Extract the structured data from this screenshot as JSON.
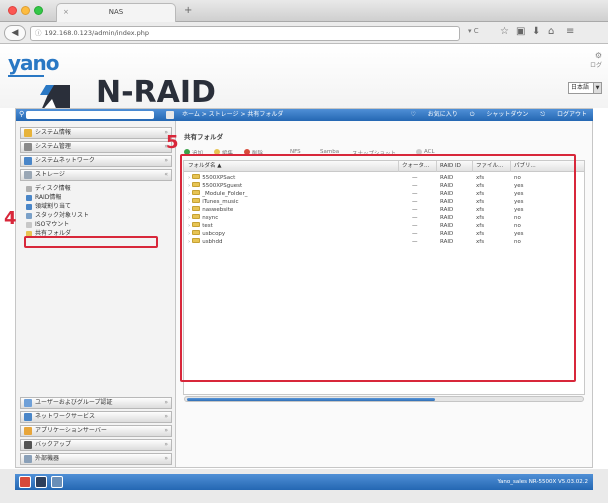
{
  "browser": {
    "tab_title": "NAS",
    "tab_close": "×",
    "new_tab": "+",
    "url": "192.168.0.123/admin/index.php",
    "back_icon": "back-arrow-icon",
    "toolbar_icons": [
      "star-icon",
      "bookmarks-icon",
      "download-icon",
      "home-icon",
      "menu-icon"
    ]
  },
  "header": {
    "vendor_logo": "yano",
    "product_name": "N-RAID",
    "right_link_top": "ログ",
    "right_link_sub": "ログ",
    "language": "日本語"
  },
  "breadcrumb": {
    "path": "ホーム > ストレージ > 共有フォルダ",
    "favorites": "お気に入り",
    "shutdown": "シャットダウン",
    "logout": "ログアウト"
  },
  "sidebar": {
    "menu_items": [
      {
        "label": "システム情報",
        "icon": "info-icon"
      },
      {
        "label": "システム管理",
        "icon": "tools-icon"
      },
      {
        "label": "システムネットワーク",
        "icon": "network-icon"
      },
      {
        "label": "ストレージ",
        "icon": "storage-icon"
      }
    ],
    "storage_sub": [
      "ディスク情報",
      "RAID情報",
      "領域割り当て",
      "スタック対象リスト",
      "ISOマウント",
      "共有フォルダ"
    ],
    "bottom_items": [
      {
        "label": "ユーザーおよびグループ認証",
        "icon": "users-icon"
      },
      {
        "label": "ネットワークサービス",
        "icon": "network-service-icon"
      },
      {
        "label": "アプリケーションサーバー",
        "icon": "app-server-icon"
      },
      {
        "label": "バックアップ",
        "icon": "backup-icon"
      },
      {
        "label": "外部機器",
        "icon": "external-device-icon"
      }
    ]
  },
  "callouts": {
    "sidebar": "4",
    "grid": "5"
  },
  "content": {
    "title": "共有フォルダ",
    "toolbar": [
      "追加",
      "編集",
      "削除",
      "NFS",
      "Samba",
      "スナップショット",
      "ACL"
    ],
    "columns": [
      "フォルダ名 ▲",
      "クォータ...",
      "RAID ID",
      "ファイル...",
      "パブリ..."
    ],
    "rows": [
      {
        "name": "5500XPSact",
        "quota": "—",
        "raid": "RAID",
        "fs": "xfs",
        "public": "no"
      },
      {
        "name": "5500XPSguest",
        "quota": "—",
        "raid": "RAID",
        "fs": "xfs",
        "public": "yes"
      },
      {
        "name": "_Module_Folder_",
        "quota": "—",
        "raid": "RAID",
        "fs": "xfs",
        "public": "yes"
      },
      {
        "name": "iTunes_music",
        "quota": "—",
        "raid": "RAID",
        "fs": "xfs",
        "public": "yes"
      },
      {
        "name": "naswebsite",
        "quota": "—",
        "raid": "RAID",
        "fs": "xfs",
        "public": "yes"
      },
      {
        "name": "nsync",
        "quota": "—",
        "raid": "RAID",
        "fs": "xfs",
        "public": "no"
      },
      {
        "name": "test",
        "quota": "—",
        "raid": "RAID",
        "fs": "xfs",
        "public": "no"
      },
      {
        "name": "usbcopy",
        "quota": "—",
        "raid": "RAID",
        "fs": "xfs",
        "public": "yes"
      },
      {
        "name": "usbhdd",
        "quota": "—",
        "raid": "RAID",
        "fs": "xfs",
        "public": "no"
      }
    ]
  },
  "status": {
    "text": "Yano_sales  NR-5500X  V5.03.02.2",
    "colors": {
      "accent": "#2467b2",
      "highlight": "#d8273a"
    }
  }
}
